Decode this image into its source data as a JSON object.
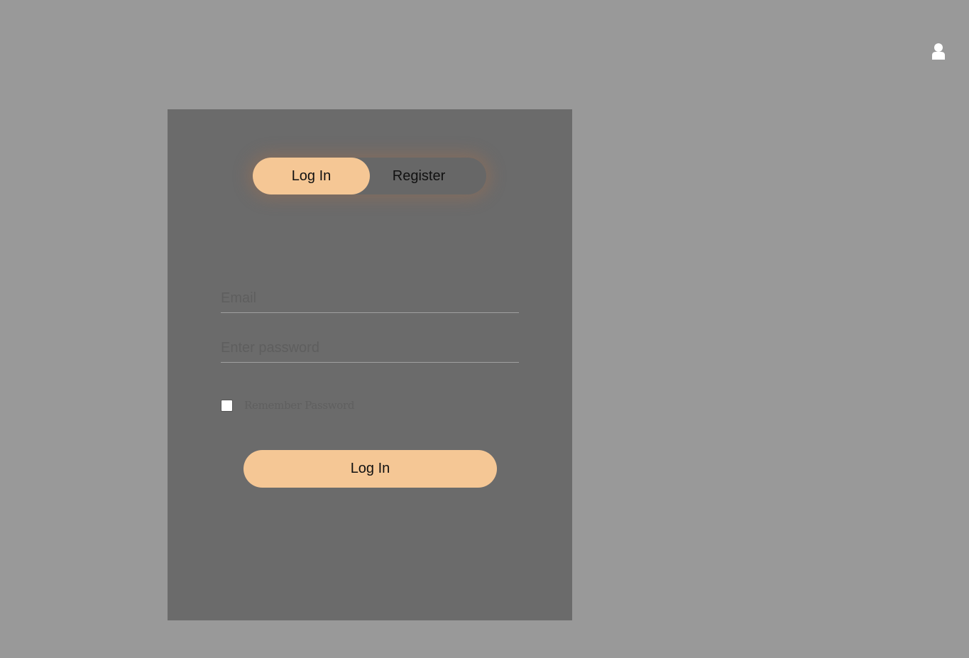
{
  "header": {
    "user_icon": "user-icon"
  },
  "auth": {
    "tabs": {
      "login_label": "Log In",
      "register_label": "Register",
      "active": "login"
    },
    "form": {
      "email_placeholder": "Email",
      "email_value": "",
      "password_placeholder": "Enter password",
      "password_value": "",
      "remember_label": "Remember Password",
      "remember_checked": false,
      "submit_label": "Log In"
    }
  },
  "colors": {
    "background": "#999999",
    "panel": "#6b6b6b",
    "accent": "#f5c795"
  }
}
